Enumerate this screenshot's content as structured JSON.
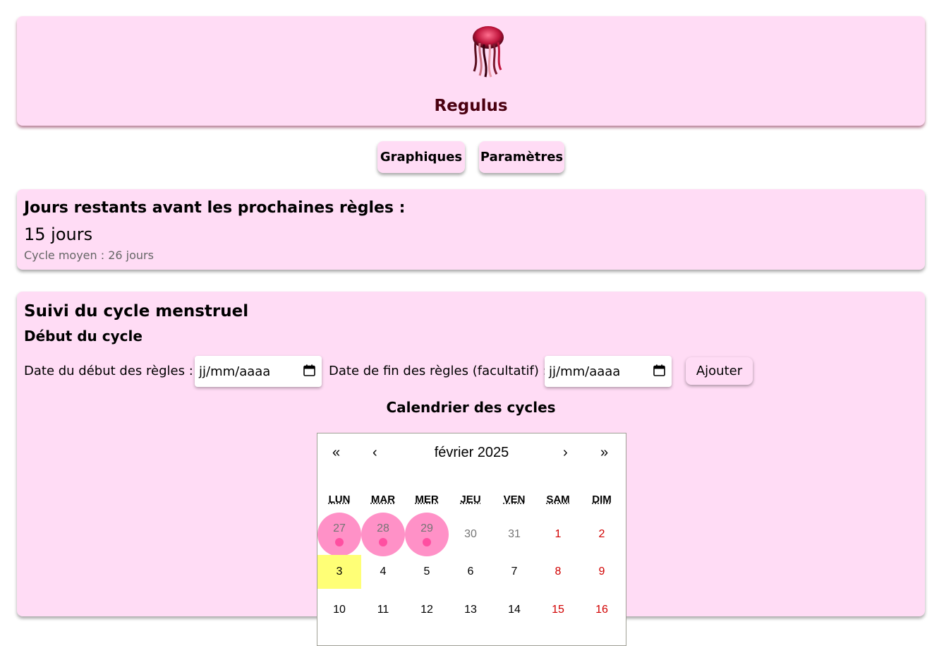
{
  "header": {
    "app_name": "Regulus",
    "logo": "jellyfish-logo"
  },
  "nav": {
    "graphiques": "Graphiques",
    "parametres": "Paramètres"
  },
  "countdown": {
    "title": "Jours restants avant les prochaines règles :",
    "value": "15 jours",
    "average": "Cycle moyen : 26 jours"
  },
  "tracker": {
    "title": "Suivi du cycle menstruel",
    "subtitle": "Début du cycle",
    "start_label": "Date du début des règles :",
    "start_placeholder": "jj/mm/aaaa",
    "end_label": "Date de fin des règles (facultatif) :",
    "end_placeholder": "jj/mm/aaaa",
    "add_label": "Ajouter",
    "calendar_title": "Calendrier des cycles"
  },
  "calendar": {
    "nav": {
      "prev_year": "«",
      "prev_month": "‹",
      "month_label": "février 2025",
      "next_month": "›",
      "next_year": "»"
    },
    "weekdays": [
      "LUN",
      "MAR",
      "MER",
      "JEU",
      "VEN",
      "SAM",
      "DIM"
    ],
    "row1": [
      "27",
      "28",
      "29",
      "30",
      "31",
      "1",
      "2"
    ],
    "row2": [
      "3",
      "4",
      "5",
      "6",
      "7",
      "8",
      "9"
    ],
    "row3": [
      "10",
      "11",
      "12",
      "13",
      "14",
      "15",
      "16"
    ],
    "colors": {
      "period": "#ff91c7",
      "period_dot": "#ff4fa1",
      "today": "#ffff76",
      "weekend": "#d10000",
      "card": "#ffdcf5"
    }
  }
}
